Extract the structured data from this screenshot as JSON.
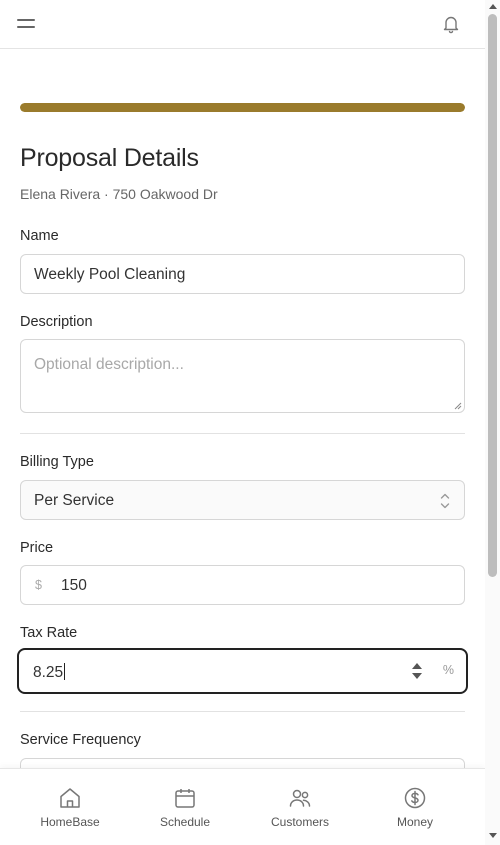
{
  "header": {
    "menu_icon": "hamburger-icon",
    "notification_icon": "bell-icon"
  },
  "progress": {
    "value": 1.0,
    "color": "#9a7b2c"
  },
  "page": {
    "title": "Proposal Details",
    "subtitle": "Elena Rivera · 750 Oakwood Dr"
  },
  "form": {
    "name": {
      "label": "Name",
      "value": "Weekly Pool Cleaning"
    },
    "description": {
      "label": "Description",
      "placeholder": "Optional description..."
    },
    "billing_type": {
      "label": "Billing Type",
      "value": "Per Service"
    },
    "price": {
      "label": "Price",
      "prefix": "$",
      "value": "150"
    },
    "tax_rate": {
      "label": "Tax Rate",
      "value": "8.25",
      "suffix": "%"
    },
    "service_frequency": {
      "label": "Service Frequency"
    }
  },
  "bottom_nav": {
    "items": [
      {
        "label": "HomeBase",
        "icon": "home-icon"
      },
      {
        "label": "Schedule",
        "icon": "calendar-icon"
      },
      {
        "label": "Customers",
        "icon": "users-icon"
      },
      {
        "label": "Money",
        "icon": "dollar-circle-icon"
      }
    ]
  }
}
